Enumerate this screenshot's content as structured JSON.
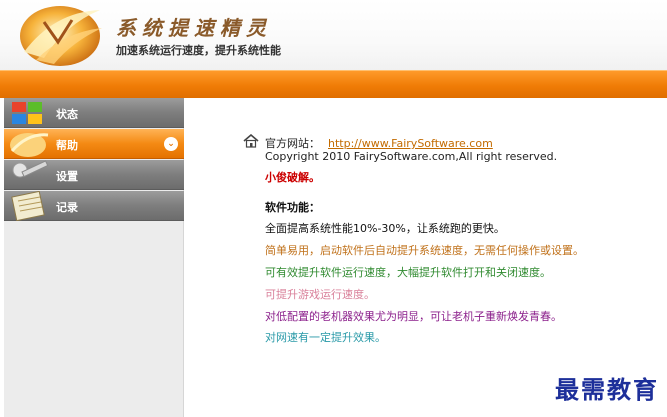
{
  "header": {
    "title": "系统提速精灵",
    "subtitle": "加速系统运行速度，提升系统性能"
  },
  "sidebar": {
    "items": [
      {
        "label": "状态",
        "icon": "windows-flag-icon",
        "active": false
      },
      {
        "label": "帮助",
        "icon": "help-ball-icon",
        "active": true
      },
      {
        "label": "设置",
        "icon": "wrench-icon",
        "active": false
      },
      {
        "label": "记录",
        "icon": "notebook-icon",
        "active": false
      }
    ]
  },
  "main": {
    "site_label": "官方网站：",
    "site_url": "http://www.FairySoftware.com",
    "copyright": "Copyright 2010 FairySoftware.com,All right reserved.",
    "cracked": "小俊破解。",
    "features_title": "软件功能：",
    "features": [
      "全面提高系统性能10%-30%，让系统跑的更快。",
      "简单易用，启动软件后自动提升系统速度，无需任何操作或设置。",
      "可有效提升软件运行速度，大幅提升软件打开和关闭速度。",
      "可提升游戏运行速度。",
      "对低配置的老机器效果尤为明显，可让老机子重新焕发青春。",
      "对网速有一定提升效果。"
    ]
  },
  "watermark": "最需教育",
  "colors": {
    "accent_orange": "#f07c06",
    "sidebar_gray": "#7e7e7e",
    "link": "#c36b00",
    "cracked_red": "#cc0000"
  }
}
